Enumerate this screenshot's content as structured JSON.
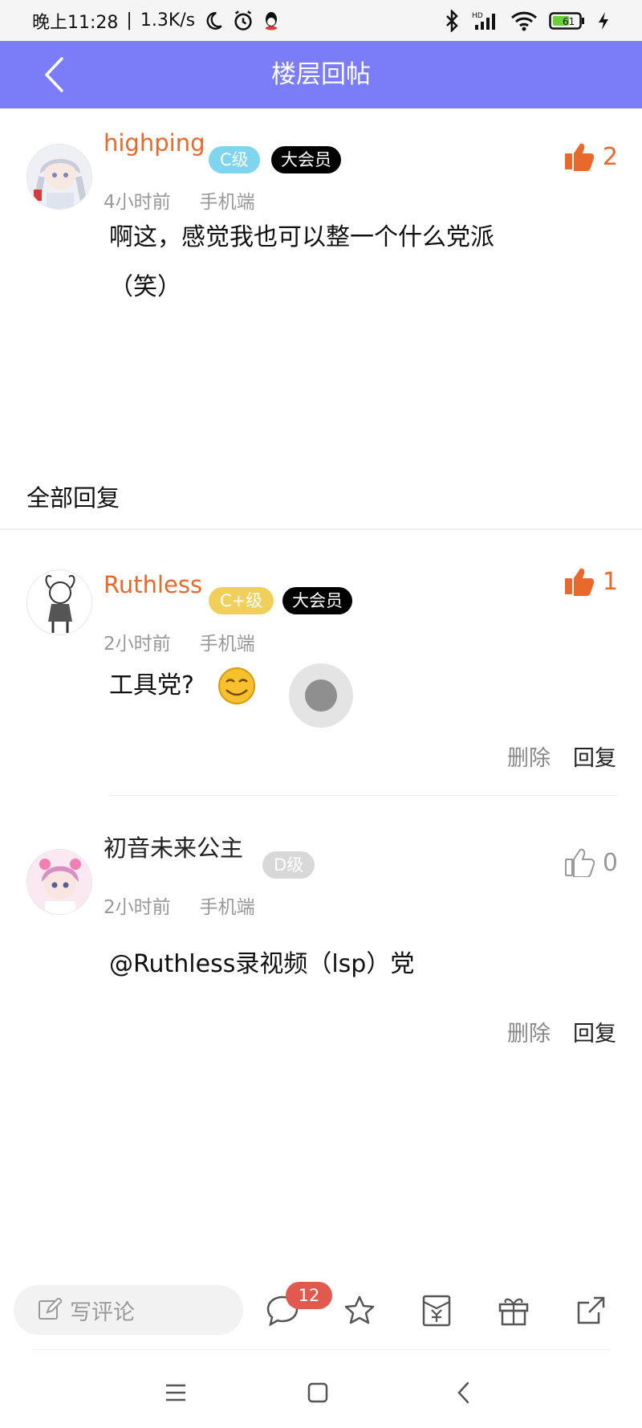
{
  "status_bar": {
    "time": "晚上11:28",
    "speed": "1.3K/s",
    "battery": "61"
  },
  "header": {
    "back_icon": "chevron-left-icon",
    "title": "楼层回帖"
  },
  "main_post": {
    "username": "highping",
    "level": "C级",
    "vip": "大会员",
    "time": "4小时前",
    "device": "手机端",
    "likes": "2",
    "content_line1": "啊这，感觉我也可以整一个什么党派",
    "content_line2": "（笑）"
  },
  "section_title": "全部回复",
  "replies": [
    {
      "username": "Ruthless",
      "level": "C+级",
      "vip": "大会员",
      "time": "2小时前",
      "device": "手机端",
      "likes": "1",
      "content": "工具党?",
      "delete_label": "删除",
      "reply_label": "回复"
    },
    {
      "username": "初音未来公主",
      "level": "D级",
      "time": "2小时前",
      "device": "手机端",
      "likes": "0",
      "content": "@Ruthless录视频（lsp）党",
      "delete_label": "删除",
      "reply_label": "回复"
    }
  ],
  "bottom_bar": {
    "comment_placeholder": "写评论",
    "comment_count": "12"
  },
  "colors": {
    "header_bg": "#7b7cf7",
    "accent_orange": "#e8692b",
    "badge_count_bg": "#e2594f"
  }
}
